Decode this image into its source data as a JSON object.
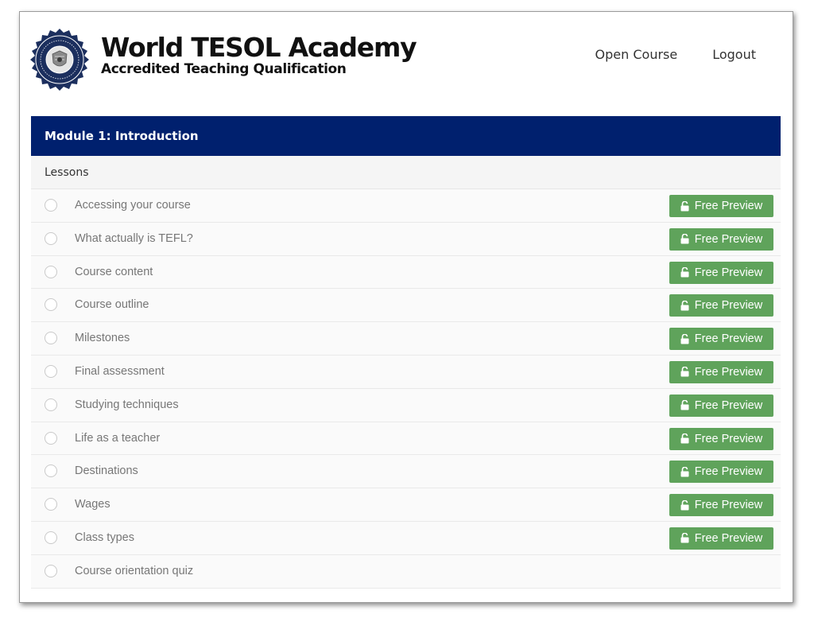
{
  "header": {
    "title": "World TESOL Academy",
    "subtitle": "Accredited Teaching Qualification",
    "nav": [
      "Open Course",
      "Logout"
    ]
  },
  "module": {
    "title": "Module 1: Introduction",
    "lessons_heading": "Lessons",
    "lessons": [
      {
        "name": "Accessing your course",
        "preview": "Free Preview"
      },
      {
        "name": "What actually is TEFL?",
        "preview": "Free Preview"
      },
      {
        "name": "Course content",
        "preview": "Free Preview"
      },
      {
        "name": "Course outline",
        "preview": "Free Preview"
      },
      {
        "name": "Milestones",
        "preview": "Free Preview"
      },
      {
        "name": "Final assessment",
        "preview": "Free Preview"
      },
      {
        "name": "Studying techniques",
        "preview": "Free Preview"
      },
      {
        "name": "Life as a teacher",
        "preview": "Free Preview"
      },
      {
        "name": "Destinations",
        "preview": "Free Preview"
      },
      {
        "name": "Wages",
        "preview": "Free Preview"
      },
      {
        "name": "Class types",
        "preview": "Free Preview"
      },
      {
        "name": "Course orientation quiz",
        "preview": ""
      }
    ]
  },
  "icons": {
    "logo": "academy-seal-icon",
    "lesson_status": "circle-icon",
    "preview": "unlock-icon"
  },
  "colors": {
    "module_header": "#00206e",
    "preview_button": "#5fa35b",
    "logo_navy": "#1c2f5e"
  }
}
